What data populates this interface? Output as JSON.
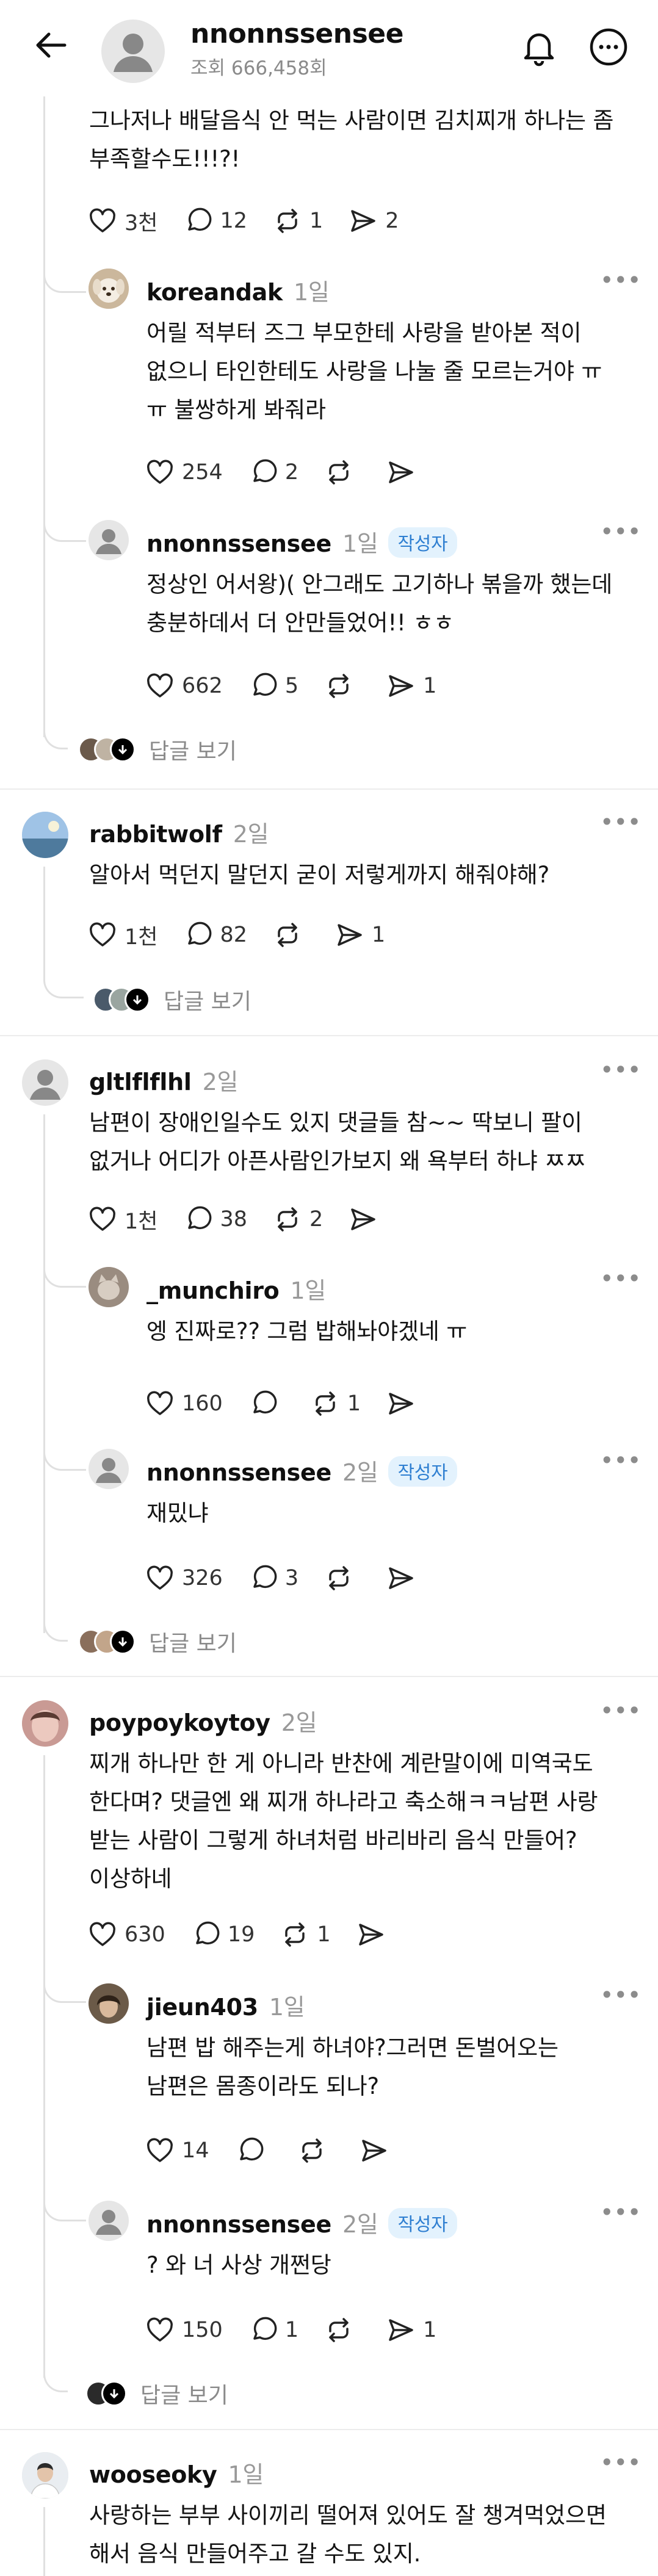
{
  "header": {
    "title": "nnonnssensee",
    "subtitle": "조회 666,458회"
  },
  "author_badge": "작성자",
  "view_replies": "답글 보기",
  "posts": [
    {
      "text": "그나저나 배달음식 안 먹는 사람이면 김치찌개 하나는 좀\n부족할수도!!!?!",
      "likes": "3천",
      "comments": "12",
      "reposts": "1",
      "shares": "2"
    },
    {
      "user": "koreandak",
      "time": "1일",
      "text": "어릴 적부터 즈그 부모한테 사랑을 받아본 적이\n없으니 타인한테도 사랑을 나눌 줄 모르는거야 ㅠ\nㅠ 불쌍하게 봐줘라",
      "likes": "254",
      "comments": "2",
      "reposts": "",
      "shares": ""
    },
    {
      "user": "nnonnssensee",
      "time": "1일",
      "text": "정상인 어서왕)( 안그래도 고기하나 볶을까 했는데\n충분하데서 더 안만들었어!! ㅎㅎ",
      "likes": "662",
      "comments": "5",
      "reposts": "",
      "shares": "1"
    },
    {
      "user": "rabbitwolf",
      "time": "2일",
      "text": "알아서 먹던지 말던지 굳이 저렇게까지 해줘야해?",
      "likes": "1천",
      "comments": "82",
      "reposts": "",
      "shares": "1"
    },
    {
      "user": "gltlflflhl",
      "time": "2일",
      "text": "남편이 장애인일수도 있지 댓글들 참~~ 딱보니 팔이\n없거나 어디가 아픈사람인가보지 왜 욕부터 하냐 ㅉㅉ",
      "likes": "1천",
      "comments": "38",
      "reposts": "2",
      "shares": ""
    },
    {
      "user": "_munchiro",
      "time": "1일",
      "text": "엥 진짜로?? 그럼 밥해놔야겠네 ㅠ",
      "likes": "160",
      "comments": "",
      "reposts": "1",
      "shares": ""
    },
    {
      "user": "nnonnssensee",
      "time": "2일",
      "text": "재밌냐",
      "likes": "326",
      "comments": "3",
      "reposts": "",
      "shares": ""
    },
    {
      "user": "poypoykoytoy",
      "time": "2일",
      "text": "찌개 하나만 한 게 아니라 반찬에 계란말이에 미역국도\n한다며? 댓글엔 왜 찌개 하나라고 축소해ㅋㅋ남편 사랑\n받는 사람이 그렇게 하녀처럼 바리바리 음식 만들어?\n이상하네",
      "likes": "630",
      "comments": "19",
      "reposts": "1",
      "shares": ""
    },
    {
      "user": "jieun403",
      "time": "1일",
      "text": "남편 밥 해주는게 하녀야?그러면 돈벌어오는\n남편은 몸종이라도 되나?",
      "likes": "14",
      "comments": "",
      "reposts": "",
      "shares": ""
    },
    {
      "user": "nnonnssensee",
      "time": "2일",
      "text": "? 와 너 사상 개쩐당",
      "likes": "150",
      "comments": "1",
      "reposts": "",
      "shares": "1"
    },
    {
      "user": "wooseoky",
      "time": "1일",
      "text": "사랑하는 부부 사이끼리 떨어져 있어도 잘 챙겨먹었으면\n해서 음식 만들어주고 갈 수도 있지."
    }
  ]
}
